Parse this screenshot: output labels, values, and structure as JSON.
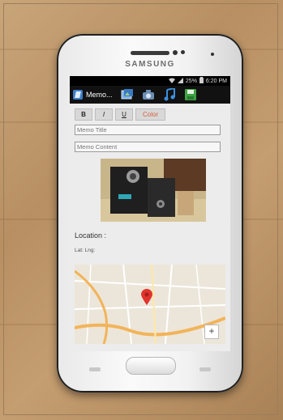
{
  "device": {
    "brand": "SAMSUNG"
  },
  "status_bar": {
    "signal": "25%",
    "time": "6:20 PM"
  },
  "action_bar": {
    "title": "Memo...",
    "icons": [
      "gallery-icon",
      "camera-icon",
      "music-icon",
      "save-icon"
    ]
  },
  "toolbar": {
    "bold_label": "B",
    "italic_label": "I",
    "underline_label": "U",
    "color_label": "Color",
    "color_accent": "#d65f3e"
  },
  "form": {
    "title_placeholder": "Memo Title",
    "content_placeholder": "Memo Content"
  },
  "location": {
    "label": "Location :",
    "latlng": "Lat: Lng:"
  },
  "map": {
    "zoom_in_label": "+"
  }
}
